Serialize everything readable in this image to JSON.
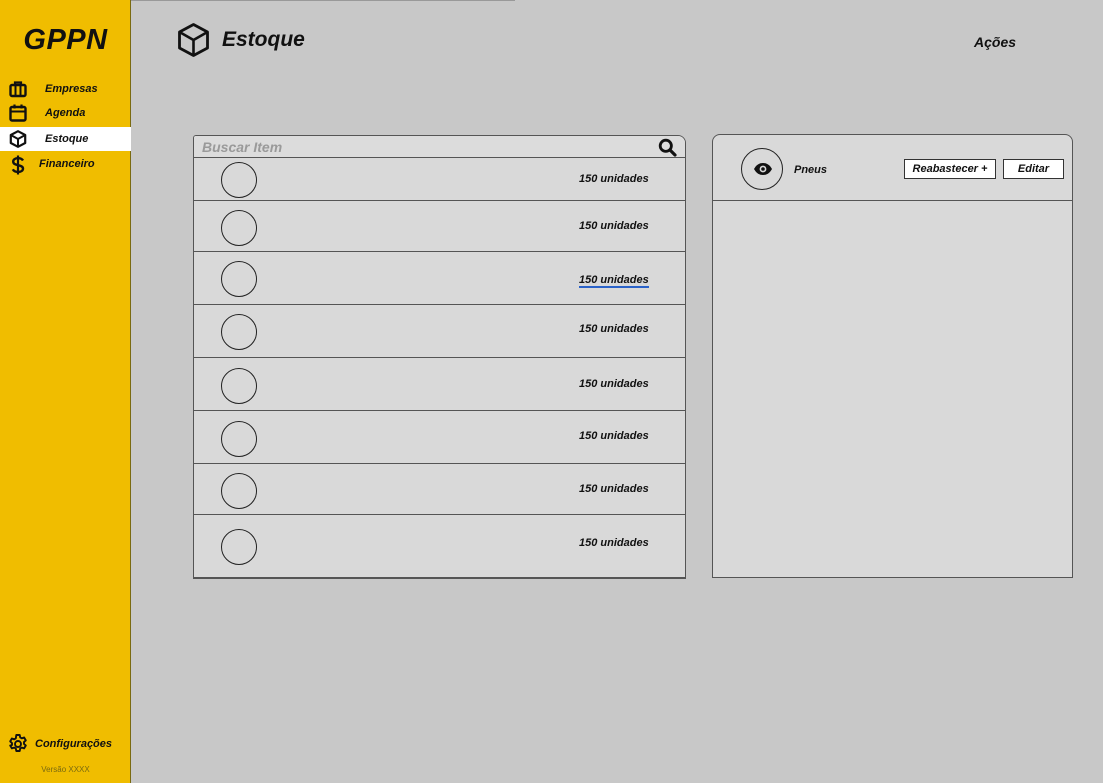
{
  "app": {
    "logo": "GPPN",
    "version": "Versão XXXX"
  },
  "sidebar": {
    "items": [
      {
        "label": "Empresas",
        "icon": "briefcase-icon",
        "active": false
      },
      {
        "label": "Agenda",
        "icon": "calendar-icon",
        "active": false
      },
      {
        "label": "Estoque",
        "icon": "box-icon",
        "active": true
      },
      {
        "label": "Financeiro",
        "icon": "dollar-icon",
        "active": false
      }
    ],
    "settings": {
      "label": "Configurações",
      "icon": "gear-icon"
    }
  },
  "header": {
    "title": "Estoque",
    "icon": "box-icon",
    "actions_label": "Ações"
  },
  "search": {
    "placeholder": "Buscar Item",
    "value": ""
  },
  "inventory": {
    "rows": [
      {
        "quantity": "150 unidades"
      },
      {
        "quantity": "150 unidades"
      },
      {
        "quantity": "150 unidades"
      },
      {
        "quantity": "150 unidades"
      },
      {
        "quantity": "150 unidades"
      },
      {
        "quantity": "150 unidades"
      },
      {
        "quantity": "150 unidades"
      },
      {
        "quantity": "150 unidades"
      }
    ]
  },
  "detail": {
    "item_name": "Pneus",
    "restock_label": "Reabastecer +",
    "edit_label": "Editar",
    "view_icon": "eye-icon"
  },
  "colors": {
    "sidebar": "#f0bd00",
    "background": "#c8c8c8",
    "panel": "#d9d9d9",
    "active_nav": "#ffffff",
    "underline": "#2a62c9"
  }
}
